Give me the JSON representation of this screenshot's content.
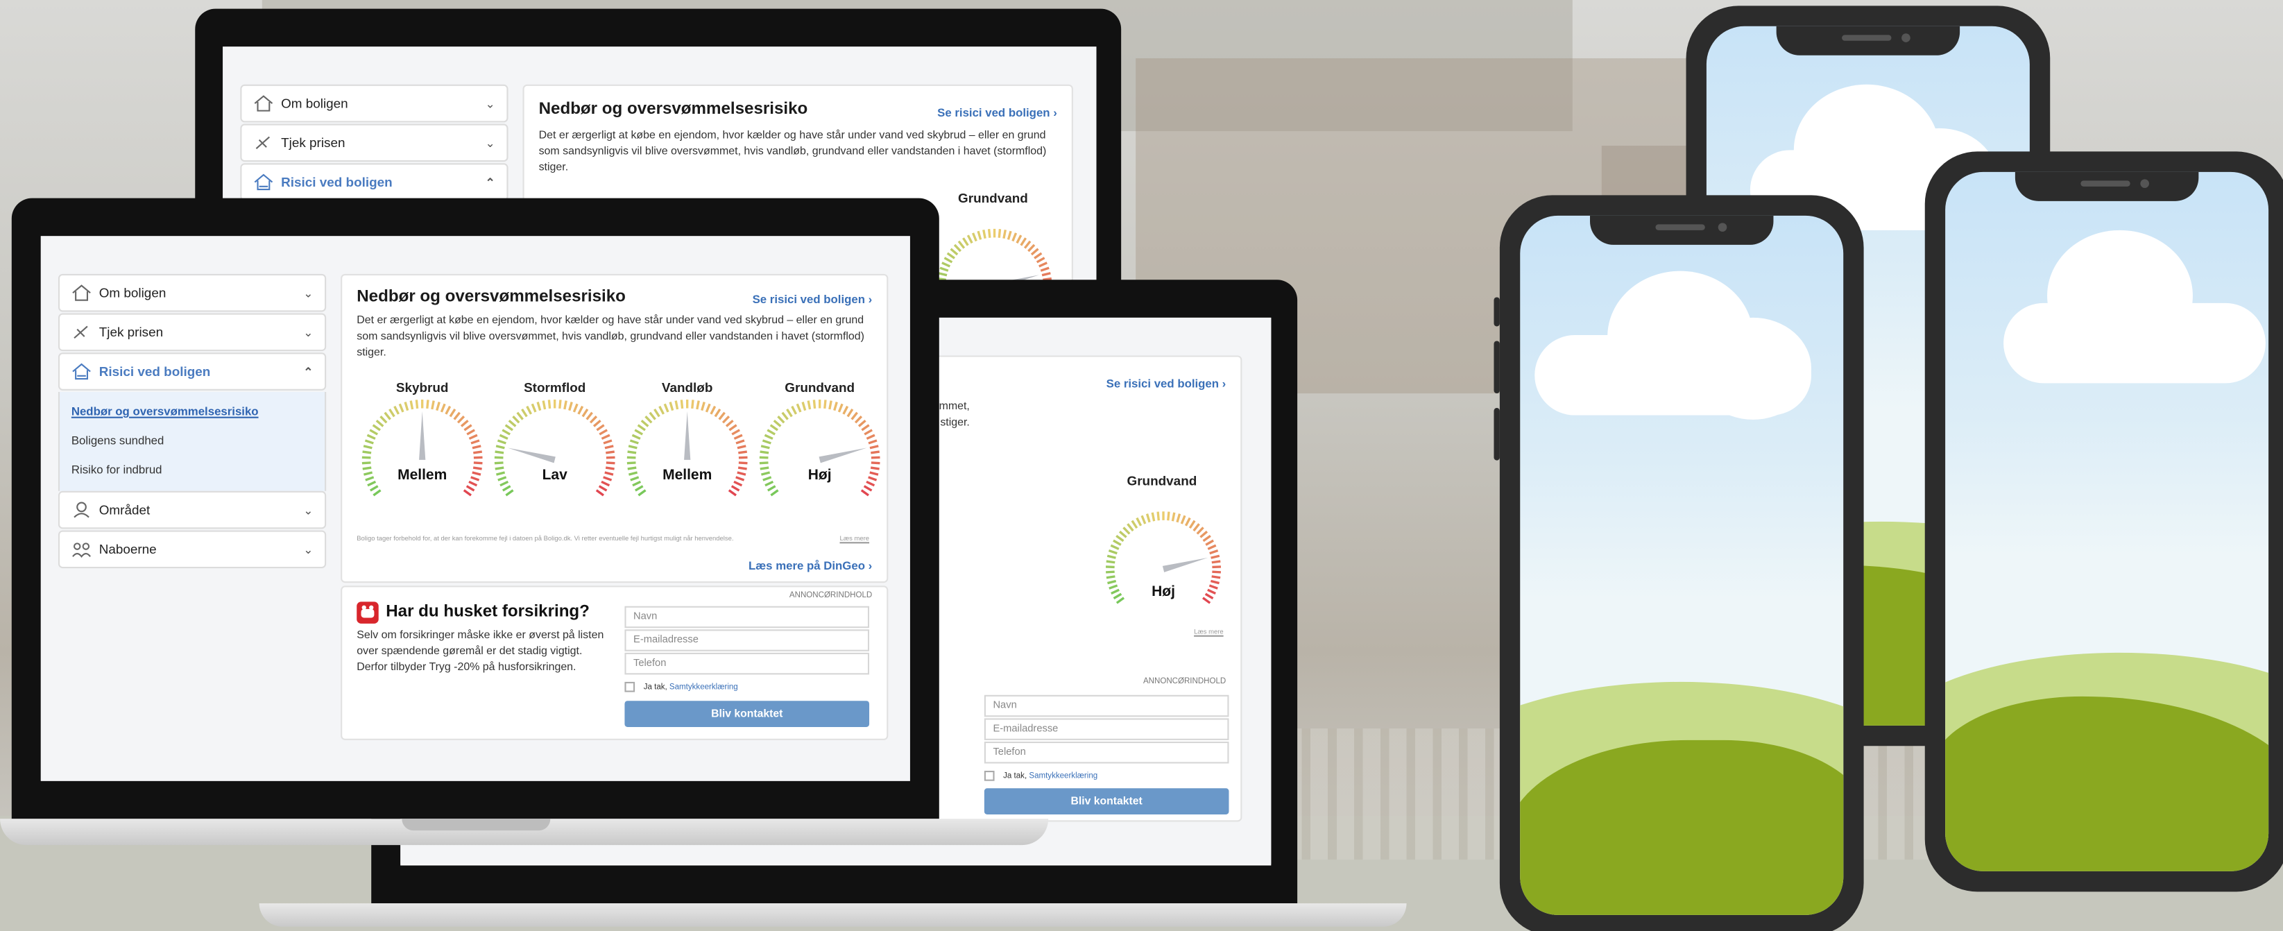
{
  "nav": {
    "items": [
      {
        "label": "Om boligen"
      },
      {
        "label": "Tjek prisen"
      },
      {
        "label": "Risici ved boligen"
      },
      {
        "label": "Området"
      },
      {
        "label": "Naboerne"
      }
    ],
    "sub_items": [
      {
        "label": "Nedbør og oversvømmelsesrisiko"
      },
      {
        "label": "Boligens sundhed"
      },
      {
        "label": "Risiko for indbrud"
      }
    ]
  },
  "risk": {
    "title": "Nedbør og oversvømmelsesrisiko",
    "see_link": "Se risici ved boligen ›",
    "description": "Det er ærgerligt at købe en ejendom, hvor kælder og have står under vand ved skybrud – eller en grund som sandsynligvis vil blive oversvømmet, hvis vandløb, grundvand eller vandstanden i havet (stormflod) stiger.",
    "gauges": [
      {
        "label": "Skybrud",
        "value": "Mellem",
        "level": 0.5
      },
      {
        "label": "Stormflod",
        "value": "Lav",
        "level": 0.2
      },
      {
        "label": "Vandløb",
        "value": "Mellem",
        "level": 0.5
      },
      {
        "label": "Grundvand",
        "value": "Høj",
        "level": 0.8
      }
    ],
    "disclaimer": "Boligo tager forbehold for, at der kan forekomme fejl i datoen på Boligo.dk. Vi retter eventuelle fejl hurtigst muligt når henvendelse.",
    "read_more_small": "Læs mere",
    "read_more_dingeo": "Læs mere på DinGeo ›"
  },
  "insurance": {
    "ad_tag": "ANNONCØRINDHOLD",
    "title": "Har du husket forsikring?",
    "text": "Selv om forsikringer måske ikke er øverst på listen over spændende gøremål er det stadig vigtigt. Derfor tilbyder Tryg -20% på husforsikringen.",
    "name_placeholder": "Navn",
    "email_placeholder": "E-mailadresse",
    "phone_placeholder": "Telefon",
    "consent_prefix": "Ja tak,",
    "consent_link": "Samtykkeerklæring",
    "button": "Bliv kontaktet"
  },
  "colors": {
    "accent": "#3a70b8",
    "button": "#6a98c9",
    "grass_dark": "#8aa820",
    "grass_light": "#c7dc8a"
  }
}
